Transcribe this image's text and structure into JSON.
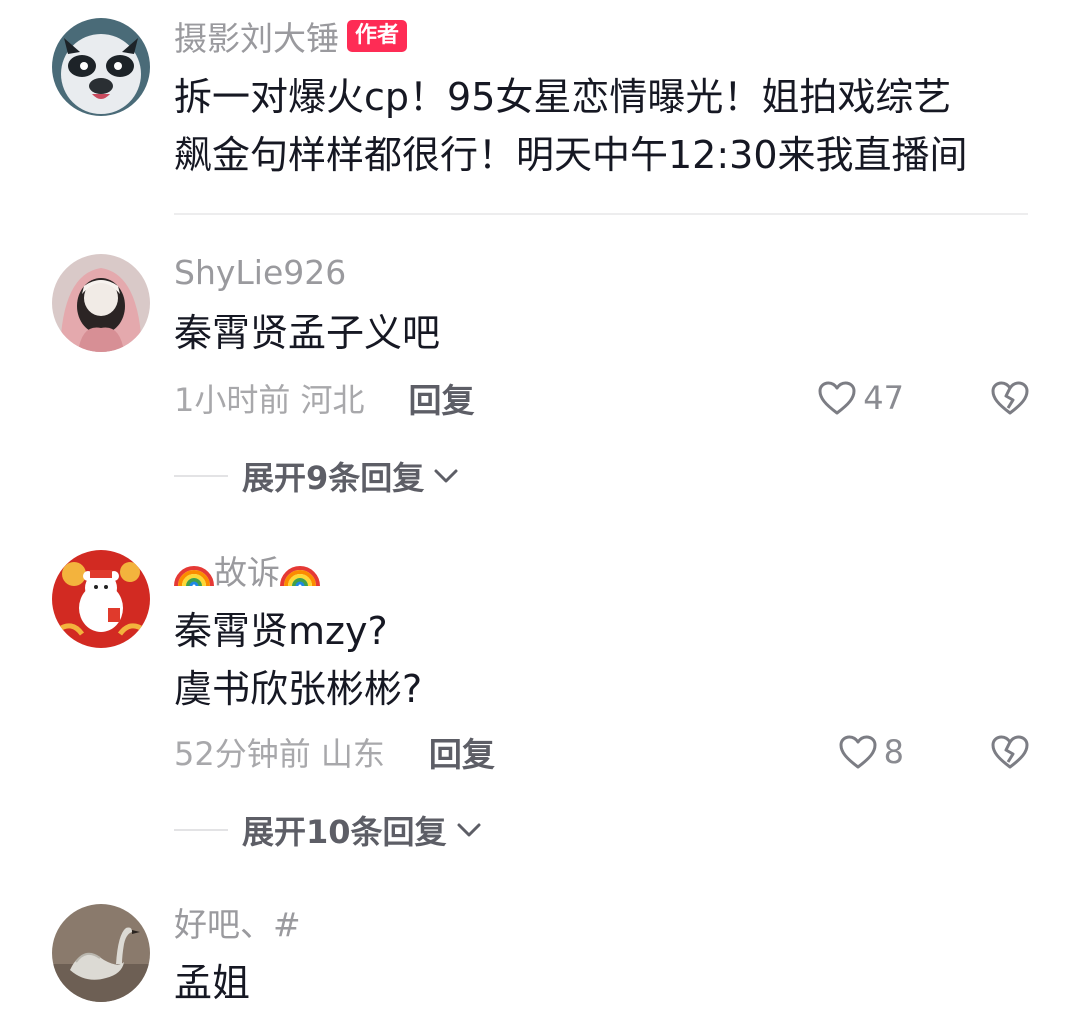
{
  "comments": [
    {
      "username": "摄影刘大锤",
      "badge": "作者",
      "lines": [
        "拆一对爆火cp！95女星恋情曝光！姐拍戏综艺",
        "飙金句样样都很行！明天中午12:30来我直播间"
      ],
      "avatar_icon": "panda-avatar-icon"
    },
    {
      "username": "ShyLie926",
      "lines": [
        "秦霄贤孟子义吧"
      ],
      "time_location": "1小时前 河北",
      "reply_label": "回复",
      "likes": "47",
      "expand_label": "展开9条回复",
      "avatar_icon": "hooded-girl-avatar-icon"
    },
    {
      "username": "故诉",
      "username_decoration": "rainbow-icon",
      "lines": [
        "秦霄贤mzy?",
        "虞书欣张彬彬?"
      ],
      "time_location": "52分钟前 山东",
      "reply_label": "回复",
      "likes": "8",
      "expand_label": "展开10条回复",
      "avatar_icon": "cartoon-bear-avatar-icon"
    },
    {
      "username": "好吧、#",
      "lines": [
        "孟姐"
      ],
      "avatar_icon": "swan-avatar-icon"
    }
  ],
  "colors": {
    "author_badge": "#fe2c55",
    "username": "#9a9a9e",
    "text": "#161823",
    "meta": "#a8a8ab",
    "reply": "#5d5e66"
  }
}
